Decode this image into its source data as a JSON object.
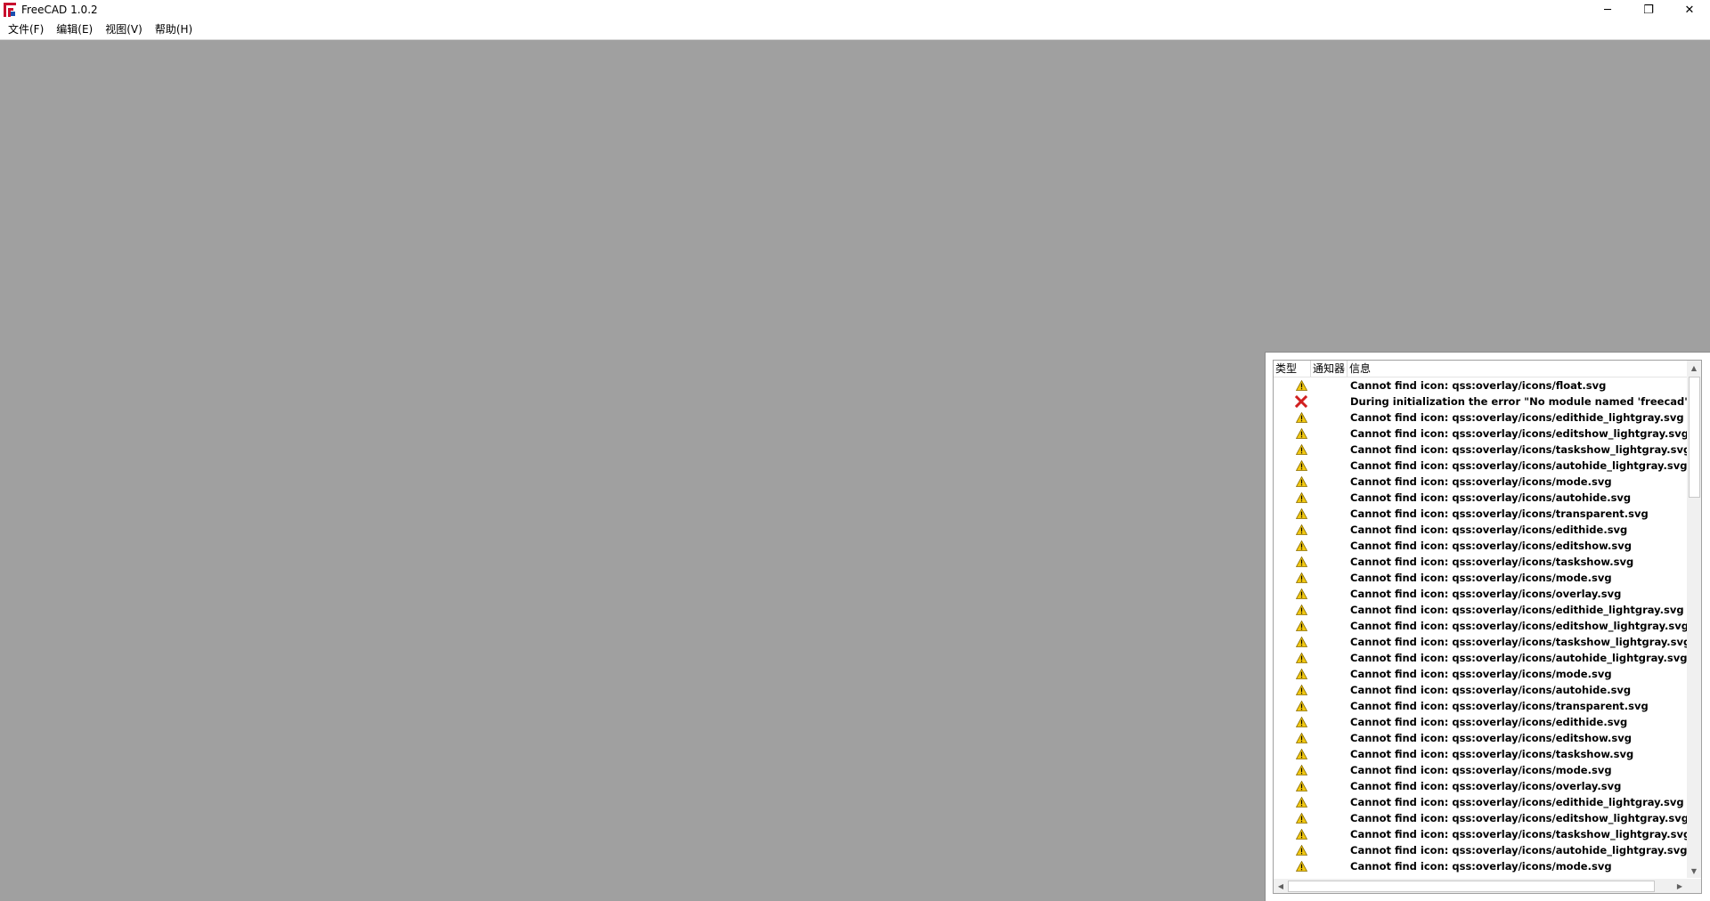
{
  "window": {
    "title": "FreeCAD 1.0.2",
    "controls": {
      "minimize": "─",
      "restore": "❐",
      "close": "✕"
    }
  },
  "menubar": {
    "items": [
      "文件(F)",
      "编辑(E)",
      "视图(V)",
      "帮助(H)"
    ]
  },
  "report_view": {
    "headers": {
      "type": "类型",
      "notifier": "通知器",
      "message": "信息"
    },
    "rows": [
      {
        "type": "warning",
        "text": "Cannot find icon: qss:overlay/icons/float.svg"
      },
      {
        "type": "error",
        "text": "During initialization the error \"No module named 'freecad'\" occurre"
      },
      {
        "type": "warning",
        "text": "Cannot find icon: qss:overlay/icons/edithide_lightgray.svg"
      },
      {
        "type": "warning",
        "text": "Cannot find icon: qss:overlay/icons/editshow_lightgray.svg"
      },
      {
        "type": "warning",
        "text": "Cannot find icon: qss:overlay/icons/taskshow_lightgray.svg"
      },
      {
        "type": "warning",
        "text": "Cannot find icon: qss:overlay/icons/autohide_lightgray.svg"
      },
      {
        "type": "warning",
        "text": "Cannot find icon: qss:overlay/icons/mode.svg"
      },
      {
        "type": "warning",
        "text": "Cannot find icon: qss:overlay/icons/autohide.svg"
      },
      {
        "type": "warning",
        "text": "Cannot find icon: qss:overlay/icons/transparent.svg"
      },
      {
        "type": "warning",
        "text": "Cannot find icon: qss:overlay/icons/edithide.svg"
      },
      {
        "type": "warning",
        "text": "Cannot find icon: qss:overlay/icons/editshow.svg"
      },
      {
        "type": "warning",
        "text": "Cannot find icon: qss:overlay/icons/taskshow.svg"
      },
      {
        "type": "warning",
        "text": "Cannot find icon: qss:overlay/icons/mode.svg"
      },
      {
        "type": "warning",
        "text": "Cannot find icon: qss:overlay/icons/overlay.svg"
      },
      {
        "type": "warning",
        "text": "Cannot find icon: qss:overlay/icons/edithide_lightgray.svg"
      },
      {
        "type": "warning",
        "text": "Cannot find icon: qss:overlay/icons/editshow_lightgray.svg"
      },
      {
        "type": "warning",
        "text": "Cannot find icon: qss:overlay/icons/taskshow_lightgray.svg"
      },
      {
        "type": "warning",
        "text": "Cannot find icon: qss:overlay/icons/autohide_lightgray.svg"
      },
      {
        "type": "warning",
        "text": "Cannot find icon: qss:overlay/icons/mode.svg"
      },
      {
        "type": "warning",
        "text": "Cannot find icon: qss:overlay/icons/autohide.svg"
      },
      {
        "type": "warning",
        "text": "Cannot find icon: qss:overlay/icons/transparent.svg"
      },
      {
        "type": "warning",
        "text": "Cannot find icon: qss:overlay/icons/edithide.svg"
      },
      {
        "type": "warning",
        "text": "Cannot find icon: qss:overlay/icons/editshow.svg"
      },
      {
        "type": "warning",
        "text": "Cannot find icon: qss:overlay/icons/taskshow.svg"
      },
      {
        "type": "warning",
        "text": "Cannot find icon: qss:overlay/icons/mode.svg"
      },
      {
        "type": "warning",
        "text": "Cannot find icon: qss:overlay/icons/overlay.svg"
      },
      {
        "type": "warning",
        "text": "Cannot find icon: qss:overlay/icons/edithide_lightgray.svg"
      },
      {
        "type": "warning",
        "text": "Cannot find icon: qss:overlay/icons/editshow_lightgray.svg"
      },
      {
        "type": "warning",
        "text": "Cannot find icon: qss:overlay/icons/taskshow_lightgray.svg"
      },
      {
        "type": "warning",
        "text": "Cannot find icon: qss:overlay/icons/autohide_lightgray.svg"
      },
      {
        "type": "warning",
        "text": "Cannot find icon: qss:overlay/icons/mode.svg"
      }
    ]
  },
  "colors": {
    "workspace": "#a0a0a0",
    "warning_fill": "#f2c811",
    "error_x": "#d11f1f"
  }
}
